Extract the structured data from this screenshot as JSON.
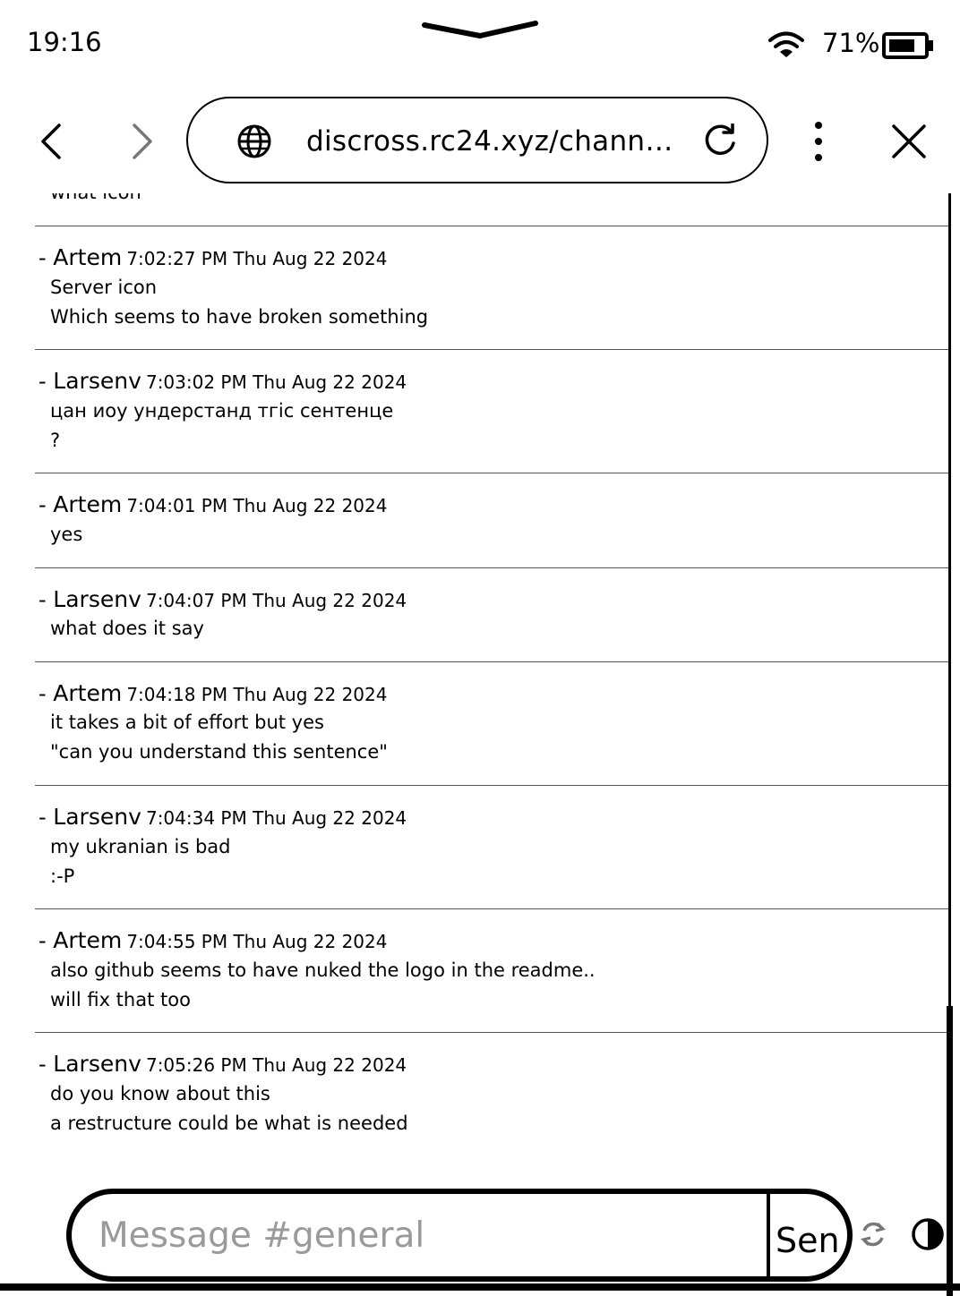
{
  "status_bar": {
    "time": "19:16",
    "battery": "71%"
  },
  "browser": {
    "url": "discross.rc24.xyz/chann…",
    "icons": [
      "back-icon",
      "forward-icon",
      "globe-icon",
      "reload-icon",
      "more-icon",
      "close-icon"
    ]
  },
  "chat": {
    "partial_top_line": "what icon",
    "messages": [
      {
        "author": "Artem",
        "timestamp": "7:02:27 PM Thu Aug 22 2024",
        "lines": [
          "Server icon",
          "Which seems to have broken something"
        ]
      },
      {
        "author": "Larsenv",
        "timestamp": "7:03:02 PM Thu Aug 22 2024",
        "lines": [
          "цан иоу ундерстанд тгіс сентенце",
          "?"
        ]
      },
      {
        "author": "Artem",
        "timestamp": "7:04:01 PM Thu Aug 22 2024",
        "lines": [
          "yes"
        ]
      },
      {
        "author": "Larsenv",
        "timestamp": "7:04:07 PM Thu Aug 22 2024",
        "lines": [
          "what does it say"
        ]
      },
      {
        "author": "Artem",
        "timestamp": "7:04:18 PM Thu Aug 22 2024",
        "lines": [
          "it takes a bit of effort but yes",
          "\"can you understand this sentence\""
        ]
      },
      {
        "author": "Larsenv",
        "timestamp": "7:04:34 PM Thu Aug 22 2024",
        "lines": [
          "my ukranian is bad",
          ":-P"
        ]
      },
      {
        "author": "Artem",
        "timestamp": "7:04:55 PM Thu Aug 22 2024",
        "lines": [
          "also github seems to have nuked the logo in the readme..",
          "will fix that too"
        ]
      },
      {
        "author": "Larsenv",
        "timestamp": "7:05:26 PM Thu Aug 22 2024",
        "lines": [
          "do you know about this",
          "a restructure could be what is needed"
        ]
      }
    ]
  },
  "composer": {
    "placeholder": "Message #general",
    "send_label": "Sen"
  }
}
